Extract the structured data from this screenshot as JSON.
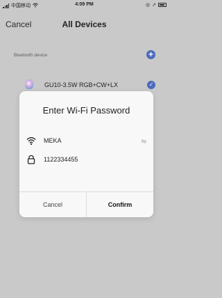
{
  "status_bar": {
    "carrier": "中国移动",
    "time": "4:09 PM"
  },
  "nav": {
    "cancel_label": "Cancel",
    "title": "All Devices"
  },
  "section": {
    "label": "Bluetooth device"
  },
  "device": {
    "name": "GU10-3.5W RGB+CW+LX"
  },
  "modal": {
    "title": "Enter Wi-Fi Password",
    "wifi_name": "MEKA",
    "password": "1122334455",
    "cancel_label": "Cancel",
    "confirm_label": "Confirm"
  },
  "icons": {
    "wifi": "wifi-icon",
    "lock": "lock-icon",
    "switch": "switch-network-icon",
    "add": "add-icon",
    "check": "check-icon",
    "bulb": "bulb-icon"
  },
  "colors": {
    "accent": "#4b6bbd",
    "overlay_bg": "#c9c9c9",
    "modal_bg": "#f8f8f8"
  }
}
